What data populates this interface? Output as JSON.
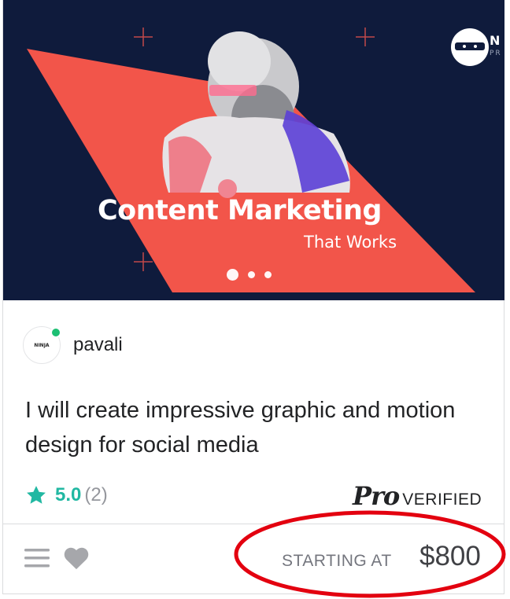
{
  "hero": {
    "headline": "Content Marketing",
    "subheadline": "That Works",
    "brand_mark": "N",
    "brand_small": "PR",
    "carousel_dots": 3,
    "active_dot": 1
  },
  "seller": {
    "name": "pavali",
    "avatar_text": "NINJA",
    "online": true
  },
  "gig": {
    "title": "I will create impressive graphic and motion design for social media"
  },
  "rating": {
    "value": "5.0",
    "count": "(2)"
  },
  "badge": {
    "pro": "Pro",
    "verified": "VERIFIED"
  },
  "footer": {
    "starting_label": "STARTING AT",
    "price": "$800"
  },
  "colors": {
    "hero_bg": "#0f1b3c",
    "hero_shape": "#f2554a",
    "rating": "#21b8a2",
    "online": "#1dbf73",
    "annotation": "#e3000f"
  },
  "icons": [
    "plus-icon",
    "menu-icon",
    "heart-icon",
    "star-icon"
  ]
}
